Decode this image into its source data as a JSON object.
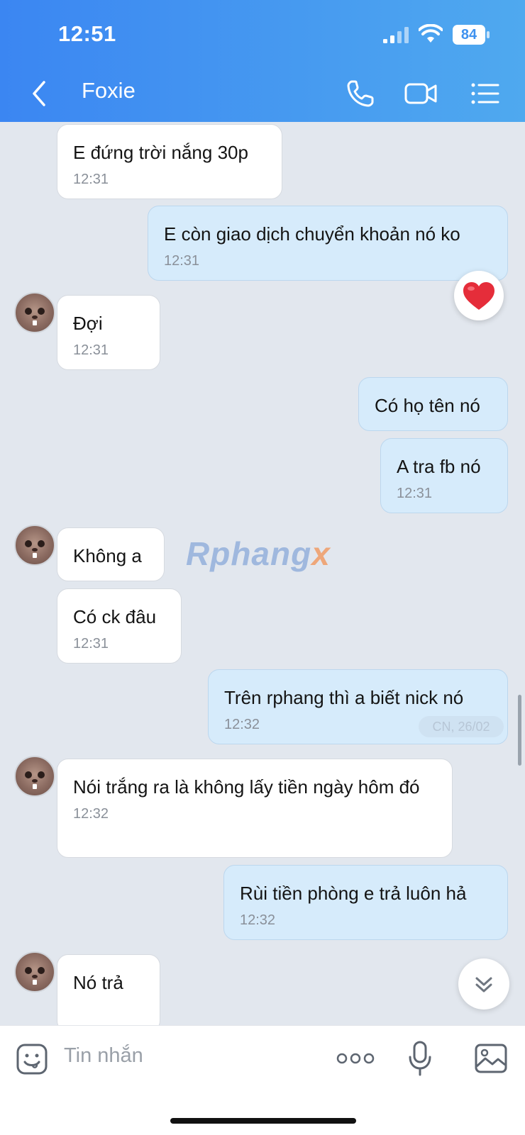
{
  "status_bar": {
    "time": "12:51",
    "battery": "84"
  },
  "header": {
    "contact_name": "Foxie"
  },
  "messages": [
    {
      "text": "E đứng trời nắng 30p",
      "time": "12:31",
      "direction": "incoming"
    },
    {
      "text": "E còn giao dịch chuyển khoản nó ko",
      "time": "12:31",
      "direction": "outgoing",
      "reaction": "heart"
    },
    {
      "text": "Đợi",
      "time": "12:31",
      "direction": "incoming"
    },
    {
      "text": "Có họ tên nó",
      "time": "",
      "direction": "outgoing"
    },
    {
      "text": "A tra fb nó",
      "time": "12:31",
      "direction": "outgoing"
    },
    {
      "text": "Không a",
      "time": "",
      "direction": "incoming"
    },
    {
      "text": "Có ck đâu",
      "time": "12:31",
      "direction": "incoming"
    },
    {
      "text": "Trên rphang thì a biết nick nó",
      "time": "12:32",
      "direction": "outgoing"
    },
    {
      "text": "Nói trắng ra là không lấy tiền ngày hôm đó",
      "time": "12:32",
      "direction": "incoming"
    },
    {
      "text": "Rùi tiền phòng e trả luôn hả",
      "time": "12:32",
      "direction": "outgoing"
    },
    {
      "text": "Nó trả",
      "time": "",
      "direction": "incoming"
    }
  ],
  "date_chip": "CN, 26/02",
  "watermark": {
    "main": "Rphang",
    "accent": "x"
  },
  "composer": {
    "placeholder": "Tin nhắn"
  },
  "colors": {
    "header_start": "#3b86f2",
    "header_end": "#4fa9ef",
    "outgoing_bubble": "#d6ebfb",
    "incoming_bubble": "#ffffff",
    "background": "#e2e7ee"
  }
}
